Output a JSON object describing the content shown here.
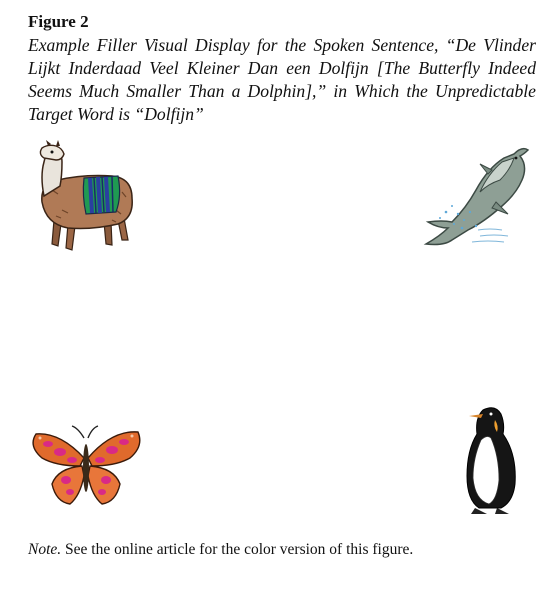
{
  "figure": {
    "label": "Figure 2",
    "caption": "Example Filler Visual Display for the Spoken Sentence, “De Vlinder Lijkt Inderdaad Veel Kleiner Dan een Dolfijn [The Butterfly Indeed Seems Much Smaller Than a Dolphin],” in Which the Unpredictable Target Word is “Dolfijn”",
    "images": [
      {
        "icon": "llama-icon"
      },
      {
        "icon": "dolphin-icon"
      },
      {
        "icon": "butterfly-icon"
      },
      {
        "icon": "penguin-icon"
      }
    ],
    "note_label": "Note.",
    "note_text": " See the online article for the color version of this figure."
  }
}
